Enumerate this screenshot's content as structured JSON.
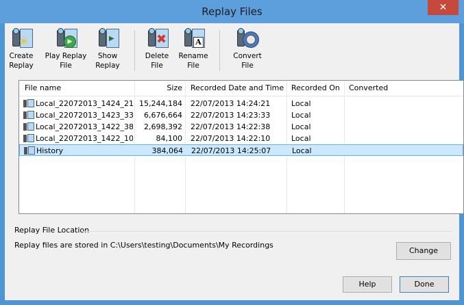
{
  "window": {
    "title": "Replay Files",
    "close_glyph": "✕"
  },
  "toolbar": {
    "buttons": [
      {
        "line1": "Create",
        "line2": "Replay",
        "icon": "create-replay-icon"
      },
      {
        "line1": "Play Replay",
        "line2": "File",
        "icon": "play-replay-icon"
      },
      {
        "line1": "Show",
        "line2": "Replay",
        "icon": "show-replay-icon"
      },
      {
        "line1": "Delete",
        "line2": "File",
        "icon": "delete-file-icon"
      },
      {
        "line1": "Rename",
        "line2": "File",
        "icon": "rename-file-icon"
      },
      {
        "line1": "Convert",
        "line2": "File",
        "icon": "convert-file-icon"
      }
    ]
  },
  "list": {
    "columns": [
      "File name",
      "Size",
      "Recorded Date and Time",
      "Recorded On",
      "Converted"
    ],
    "rows": [
      {
        "name": "Local_22072013_1424_21",
        "size": "15,244,184",
        "date": "22/07/2013 14:24:21",
        "on": "Local",
        "converted": ""
      },
      {
        "name": "Local_22072013_1423_33",
        "size": "6,676,664",
        "date": "22/07/2013 14:23:33",
        "on": "Local",
        "converted": ""
      },
      {
        "name": "Local_22072013_1422_38",
        "size": "2,698,392",
        "date": "22/07/2013 14:22:38",
        "on": "Local",
        "converted": ""
      },
      {
        "name": "Local_22072013_1422_10",
        "size": "84,100",
        "date": "22/07/2013 14:22:10",
        "on": "Local",
        "converted": ""
      },
      {
        "name": "History",
        "size": "384,064",
        "date": "22/07/2013 14:25:07",
        "on": "Local",
        "converted": "",
        "selected": true
      }
    ]
  },
  "location": {
    "label": "Replay File Location",
    "text": "Replay files are stored in C:\\Users\\testing\\Documents\\My Recordings",
    "change_label": "Change"
  },
  "footer": {
    "help_label": "Help",
    "done_label": "Done"
  },
  "colors": {
    "titlebar": "#5d9fdc",
    "close": "#c7483c",
    "selection": "#cce8ff"
  }
}
